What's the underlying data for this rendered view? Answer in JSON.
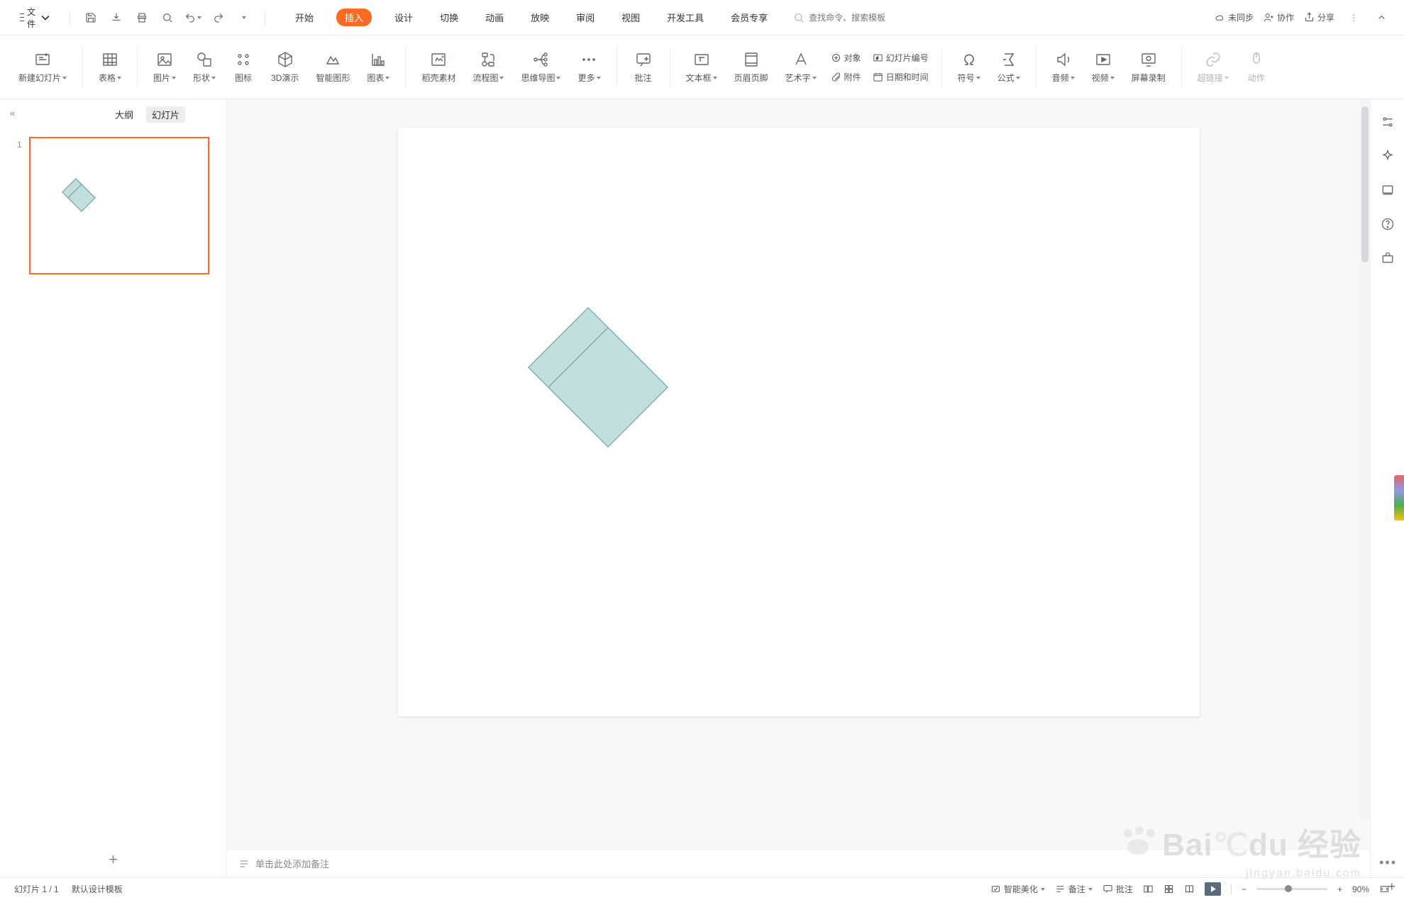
{
  "menu": {
    "file": "文件",
    "tabs": [
      "开始",
      "插入",
      "设计",
      "切换",
      "动画",
      "放映",
      "审阅",
      "视图",
      "开发工具",
      "会员专享"
    ],
    "active_tab_index": 1,
    "search_placeholder": "查找命令、搜索模板",
    "right": {
      "unsynced": "未同步",
      "collab": "协作",
      "share": "分享"
    }
  },
  "ribbon": {
    "new_slide": "新建幻灯片",
    "table": "表格",
    "picture": "图片",
    "shapes": "形状",
    "icon": "图标",
    "threeD": "3D演示",
    "smart": "智能图形",
    "chart": "图表",
    "docer": "稻壳素材",
    "flow": "流程图",
    "mind": "思维导图",
    "more": "更多",
    "comment": "批注",
    "textbox": "文本框",
    "headerfooter": "页眉页脚",
    "wordart": "艺术字",
    "object": "对象",
    "slidenum": "幻灯片编号",
    "attach": "附件",
    "datetime": "日期和时间",
    "symbol": "符号",
    "formula": "公式",
    "audio": "音频",
    "video": "视频",
    "screenrec": "屏幕录制",
    "hyperlink": "超链接",
    "action": "动作"
  },
  "panel": {
    "outline": "大纲",
    "slides": "幻灯片",
    "slide_number": "1"
  },
  "notes": {
    "placeholder": "单击此处添加备注"
  },
  "status": {
    "slide_counter": "幻灯片 1 / 1",
    "template": "默认设计模板",
    "beautify": "智能美化",
    "notes_btn": "备注",
    "comments_btn": "批注",
    "zoom": "90%"
  },
  "watermark": {
    "brand": "Bai",
    "brand2": "du",
    "label": "经验",
    "url": "jingyan.baidu.com"
  }
}
